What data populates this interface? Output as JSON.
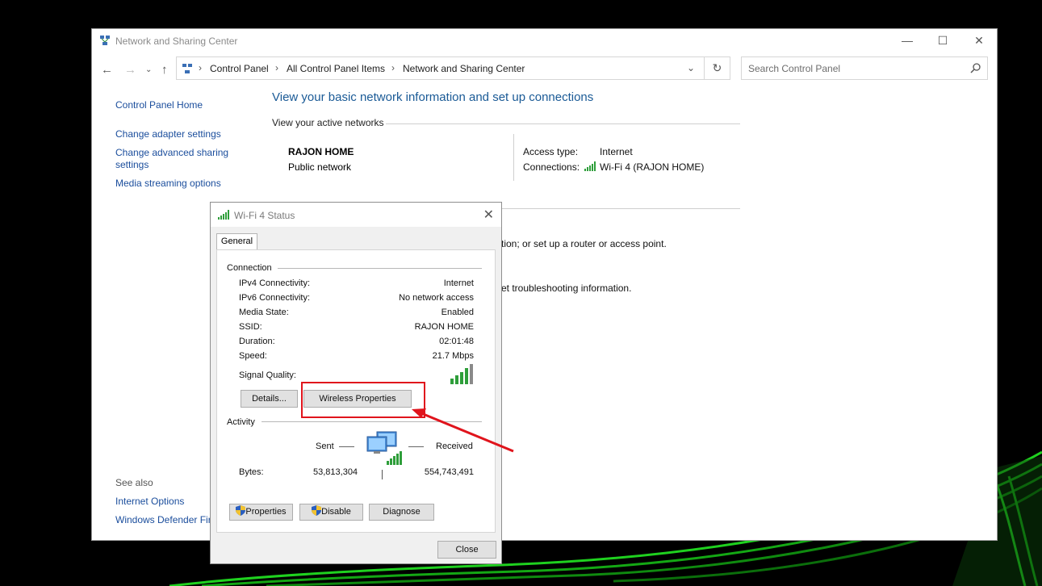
{
  "main_window": {
    "title": "Network and Sharing Center",
    "controls": {
      "minimize": "—",
      "maximize": "☐",
      "close": "✕"
    },
    "address_bar": {
      "crumbs": [
        "Control Panel",
        "All Control Panel Items",
        "Network and Sharing Center"
      ],
      "search_placeholder": "Search Control Panel"
    },
    "sidebar": {
      "home": "Control Panel Home",
      "items": [
        "Change adapter settings",
        "Change advanced sharing",
        "settings",
        "Media streaming options"
      ],
      "see_also_label": "See also",
      "see_also": [
        "Internet Options",
        "Windows Defender Fire"
      ]
    },
    "heading": "View your basic network information and set up connections",
    "active_networks_label": "View your active networks",
    "network": {
      "name": "RAJON HOME",
      "type": "Public network",
      "access_type_label": "Access type:",
      "access_type": "Internet",
      "connections_label": "Connections:",
      "connection": "Wi-Fi 4 (RAJON HOME)"
    },
    "partial_text_1": "tion; or set up a router or access point.",
    "partial_text_2": "et troubleshooting information."
  },
  "dialog": {
    "title": "Wi-Fi 4 Status",
    "close": "✕",
    "tab": "General",
    "connection_label": "Connection",
    "rows": [
      {
        "label": "IPv4 Connectivity:",
        "value": "Internet"
      },
      {
        "label": "IPv6 Connectivity:",
        "value": "No network access"
      },
      {
        "label": "Media State:",
        "value": "Enabled"
      },
      {
        "label": "SSID:",
        "value": "RAJON HOME"
      },
      {
        "label": "Duration:",
        "value": "02:01:48"
      },
      {
        "label": "Speed:",
        "value": "21.7 Mbps"
      }
    ],
    "signal_quality_label": "Signal Quality:",
    "details_button": "Details...",
    "wireless_properties_button": "Wireless Properties",
    "activity_label": "Activity",
    "sent_label": "Sent",
    "received_label": "Received",
    "bytes_label": "Bytes:",
    "bytes_sent": "53,813,304",
    "bytes_received": "554,743,491",
    "properties_button": "Properties",
    "disable_button": "Disable",
    "diagnose_button": "Diagnose",
    "close_button": "Close"
  },
  "colors": {
    "link": "#1a4d9c",
    "heading": "#1a5a96",
    "annotation_red": "#e0141c",
    "signal_green": "#2e9e3a"
  }
}
